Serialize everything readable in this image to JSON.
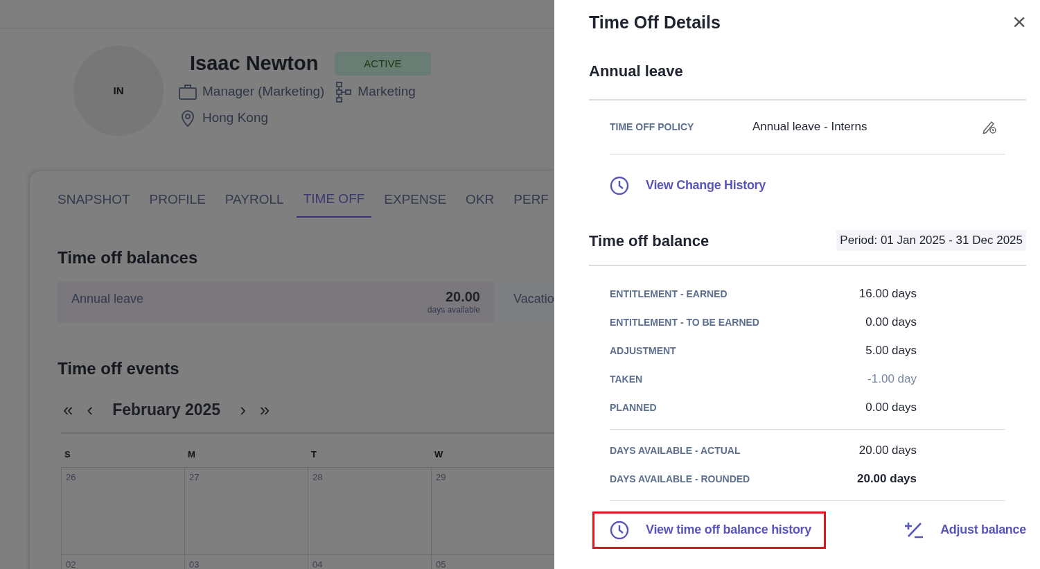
{
  "profile": {
    "initials": "IN",
    "name": "Isaac Newton",
    "status": "ACTIVE",
    "position": "Manager (Marketing)",
    "department": "Marketing",
    "location": "Hong Kong"
  },
  "tabs": [
    {
      "label": "SNAPSHOT",
      "selected": false
    },
    {
      "label": "PROFILE",
      "selected": false
    },
    {
      "label": "PAYROLL",
      "selected": false
    },
    {
      "label": "TIME OFF",
      "selected": true
    },
    {
      "label": "EXPENSE",
      "selected": false
    },
    {
      "label": "OKR",
      "selected": false
    },
    {
      "label": "PERF",
      "selected": false
    }
  ],
  "balances": {
    "title": "Time off balances",
    "cards": [
      {
        "name": "Annual leave",
        "value": "20.00",
        "unit": "days available"
      },
      {
        "name": "Vacatio"
      }
    ]
  },
  "events": {
    "title": "Time off events",
    "month": "February 2025",
    "nav": {
      "first": "«",
      "prev": "‹",
      "next": "›",
      "last": "»"
    },
    "weekdays": [
      "S",
      "M",
      "T",
      "W"
    ],
    "weeks": [
      [
        "26",
        "27",
        "28",
        "29"
      ],
      [
        "02",
        "03",
        "04",
        "05"
      ]
    ]
  },
  "panel": {
    "title": "Time Off Details",
    "close": "×",
    "leave_type": "Annual leave",
    "policy_label": "TIME OFF POLICY",
    "policy_value": "Annual leave - Interns",
    "change_history": "View Change History",
    "balance_title": "Time off balance",
    "period": "Period: 01 Jan 2025 - 31 Dec 2025",
    "groups": [
      [
        {
          "label": "ENTITLEMENT - EARNED",
          "value": "16.00 days",
          "kind": "normal"
        },
        {
          "label": "ENTITLEMENT - TO BE EARNED",
          "value": "0.00 days",
          "kind": "normal"
        },
        {
          "label": "ADJUSTMENT",
          "value": "5.00 days",
          "kind": "normal"
        },
        {
          "label": "TAKEN",
          "value": "-1.00 day",
          "kind": "negative"
        },
        {
          "label": "PLANNED",
          "value": "0.00 days",
          "kind": "normal"
        }
      ],
      [
        {
          "label": "DAYS AVAILABLE - ACTUAL",
          "value": "20.00 days",
          "kind": "normal"
        },
        {
          "label": "DAYS AVAILABLE - ROUNDED",
          "value": "20.00 days",
          "kind": "total"
        }
      ]
    ],
    "history_link": {
      "label": "View time off balance history",
      "highlighted": true
    },
    "adjust": "Adjust balance"
  }
}
